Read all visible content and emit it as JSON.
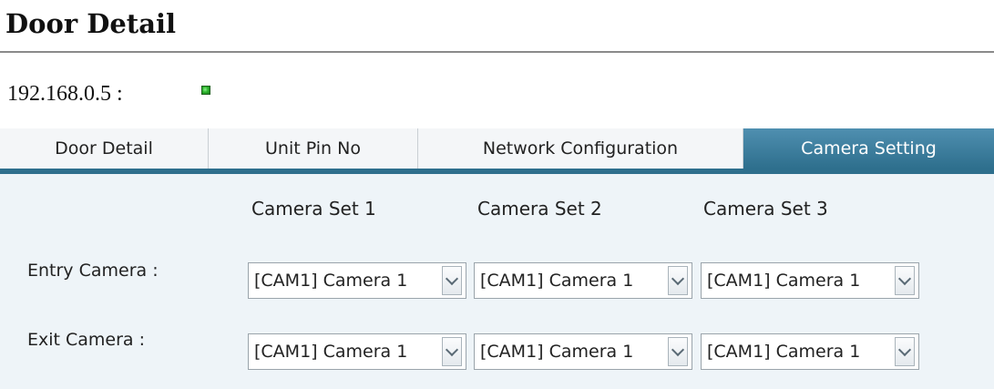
{
  "page": {
    "title": "Door Detail",
    "device_label": "192.168.0.5 :",
    "status_color": "#2db52d"
  },
  "tabs": [
    {
      "label": "Door Detail",
      "active": false
    },
    {
      "label": "Unit Pin No",
      "active": false
    },
    {
      "label": "Network Configuration",
      "active": false
    },
    {
      "label": "Camera Setting",
      "active": true
    }
  ],
  "accent_color": "#2e6f8d",
  "camera_settings": {
    "set_headers": [
      "Camera Set 1",
      "Camera Set 2",
      "Camera Set 3"
    ],
    "rows": [
      {
        "label": "Entry Camera :",
        "values": [
          "[CAM1] Camera 1",
          "[CAM1] Camera 1",
          "[CAM1] Camera 1"
        ]
      },
      {
        "label": "Exit Camera :",
        "values": [
          "[CAM1] Camera 1",
          "[CAM1] Camera 1",
          "[CAM1] Camera 1"
        ]
      }
    ]
  }
}
